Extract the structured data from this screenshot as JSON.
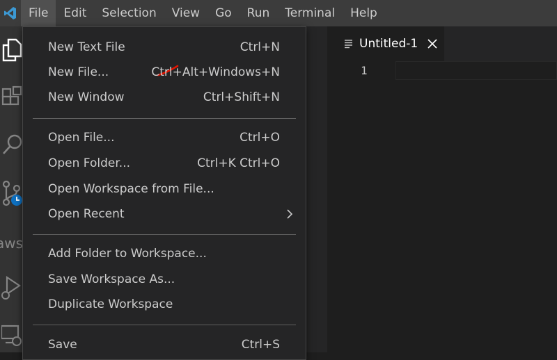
{
  "menubar": {
    "items": [
      "File",
      "Edit",
      "Selection",
      "View",
      "Go",
      "Run",
      "Terminal",
      "Help"
    ]
  },
  "activity_bar": {
    "aws_label": "aws"
  },
  "editor": {
    "tab_label": "Untitled-1",
    "line_number": "1"
  },
  "file_menu": {
    "items": [
      {
        "label": "New Text File",
        "keys": "Ctrl+N"
      },
      {
        "label": "New File...",
        "keys": "Ctrl+Alt+Windows+N"
      },
      {
        "label": "New Window",
        "keys": "Ctrl+Shift+N"
      },
      {
        "label": "Open File...",
        "keys": "Ctrl+O"
      },
      {
        "label": "Open Folder...",
        "keys": "Ctrl+K Ctrl+O"
      },
      {
        "label": "Open Workspace from File...",
        "keys": ""
      },
      {
        "label": "Open Recent",
        "keys": ""
      },
      {
        "label": "Add Folder to Workspace...",
        "keys": ""
      },
      {
        "label": "Save Workspace As...",
        "keys": ""
      },
      {
        "label": "Duplicate Workspace",
        "keys": ""
      },
      {
        "label": "Save",
        "keys": "Ctrl+S"
      }
    ]
  },
  "colors": {
    "accent_logo": "#3c99d4",
    "annotation": "#e51400"
  }
}
